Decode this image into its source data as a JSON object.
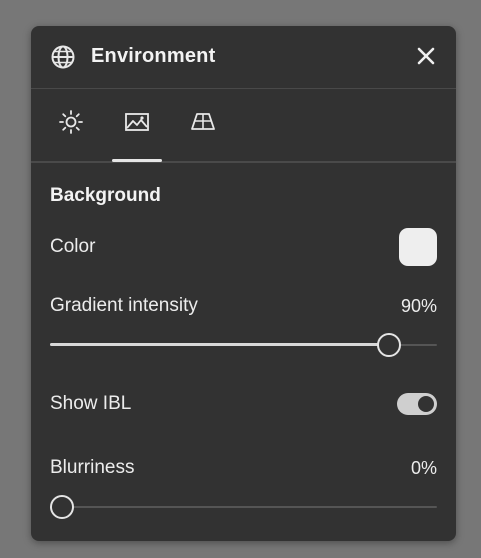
{
  "panel": {
    "title": "Environment",
    "header_icon": "globe-icon",
    "close_icon": "close-icon"
  },
  "tabs": [
    {
      "icon": "sun-icon",
      "active": false
    },
    {
      "icon": "image-icon",
      "active": true
    },
    {
      "icon": "ground-plane-icon",
      "active": false
    }
  ],
  "background": {
    "section_title": "Background",
    "color_label": "Color",
    "color_value": "#eeeeee",
    "gradient_label": "Gradient intensity",
    "gradient_value_text": "90%",
    "gradient_value": 0.9,
    "ibl_label": "Show IBL",
    "ibl_on": true,
    "blurriness_label": "Blurriness",
    "blurriness_value_text": "0%",
    "blurriness_value": 0.0
  },
  "colors": {
    "page_bg": "#777777",
    "panel_bg": "#323232",
    "accent": "#e6e6e6"
  }
}
